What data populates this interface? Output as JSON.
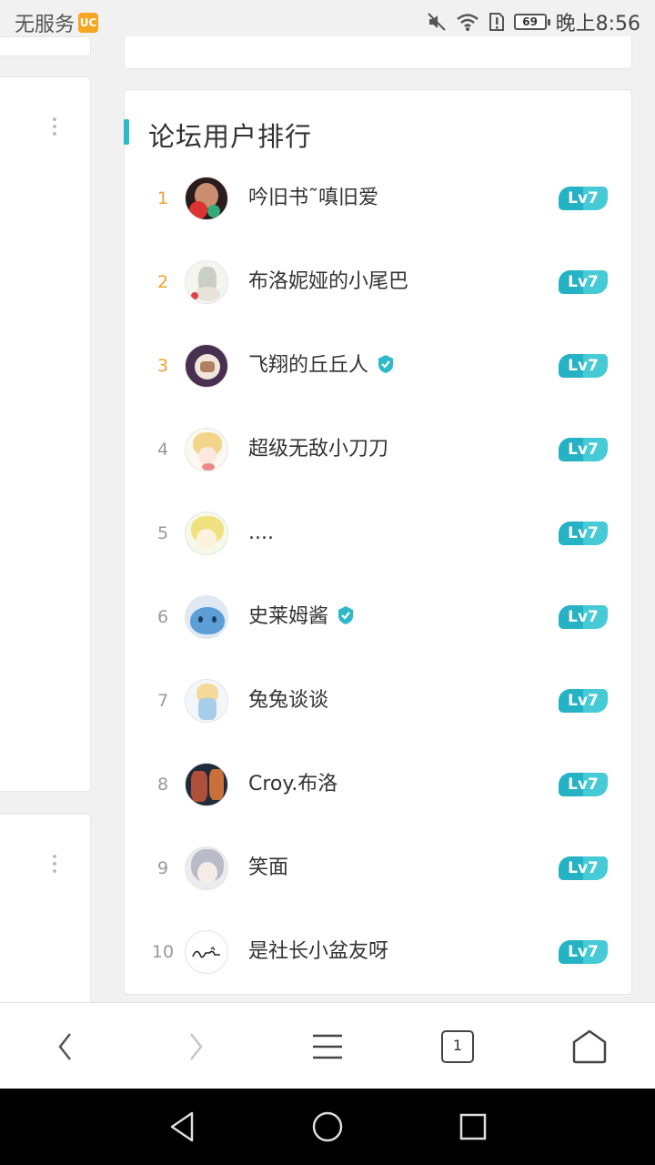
{
  "status_bar": {
    "carrier": "无服务",
    "app_icon": "uc-browser-icon",
    "battery": "69",
    "time": "晚上8:56"
  },
  "ranking": {
    "title": "论坛用户排行",
    "level_badge_color": "#2fb8c8",
    "top_rank_color": "#f0a030",
    "users": [
      {
        "rank": "1",
        "name": "吟旧书˜嗔旧爱",
        "level": "Lv7",
        "verified": false
      },
      {
        "rank": "2",
        "name": "布洛妮娅的小尾巴",
        "level": "Lv7",
        "verified": false
      },
      {
        "rank": "3",
        "name": "飞翔的丘丘人",
        "level": "Lv7",
        "verified": true
      },
      {
        "rank": "4",
        "name": "超级无敌小刀刀",
        "level": "Lv7",
        "verified": false
      },
      {
        "rank": "5",
        "name": "....",
        "level": "Lv7",
        "verified": false
      },
      {
        "rank": "6",
        "name": "史莱姆酱",
        "level": "Lv7",
        "verified": true
      },
      {
        "rank": "7",
        "name": "兔兔谈谈",
        "level": "Lv7",
        "verified": false
      },
      {
        "rank": "8",
        "name": "Croy.布洛",
        "level": "Lv7",
        "verified": false
      },
      {
        "rank": "9",
        "name": "笑面",
        "level": "Lv7",
        "verified": false
      },
      {
        "rank": "10",
        "name": "是社长小盆友呀",
        "level": "Lv7",
        "verified": false
      }
    ]
  },
  "browser_bar": {
    "tab_count": "1",
    "buttons": [
      "back-icon",
      "forward-icon",
      "menu-icon",
      "tabs-icon",
      "home-icon"
    ]
  },
  "system_nav": [
    "back-triangle-icon",
    "home-circle-icon",
    "recents-square-icon"
  ]
}
